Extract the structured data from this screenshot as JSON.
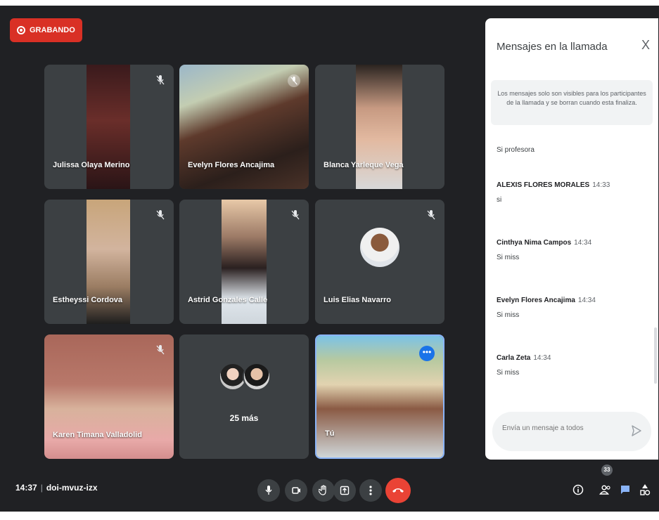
{
  "recording": {
    "label": "GRABANDO"
  },
  "participants": [
    {
      "name": "Julissa Olaya Merino"
    },
    {
      "name": "Evelyn Flores Ancajima"
    },
    {
      "name": "Blanca Yarleque Vega"
    },
    {
      "name": "Estheyssi Cordova"
    },
    {
      "name": "Astrid Gonzales Calle"
    },
    {
      "name": "Luis Elias Navarro"
    },
    {
      "name": "Karen Timana Valladolid"
    }
  ],
  "more_tile": {
    "label": "25 más"
  },
  "self_tile": {
    "name": "Tú"
  },
  "chat": {
    "title": "Mensajes en la llamada",
    "close": "X",
    "info": "Los mensajes solo son visibles para los participantes de la llamada y se borran cuando esta finaliza.",
    "first_text": "Si profesora",
    "messages": [
      {
        "sender": "ALEXIS FLORES MORALES",
        "time": "14:33",
        "text": "si"
      },
      {
        "sender": "Cinthya Nima Campos",
        "time": "14:34",
        "text": "Si miss"
      },
      {
        "sender": "Evelyn Flores Ancajima",
        "time": "14:34",
        "text": "Si miss"
      },
      {
        "sender": "Carla Zeta",
        "time": "14:34",
        "text": "Si miss"
      }
    ],
    "input_placeholder": "Envía un mensaje a todos"
  },
  "bottom": {
    "time": "14:37",
    "separator": "|",
    "meeting_code": "doi-mvuz-izx",
    "participants_count": "33"
  },
  "icons": {
    "mic": "mic-icon",
    "camera": "camera-icon",
    "raise_hand": "hand-icon",
    "present": "present-icon",
    "more": "more-vert-icon",
    "end_call": "end-call-icon",
    "info": "info-icon",
    "people": "people-icon",
    "chat": "chat-icon",
    "activities": "activities-icon"
  },
  "colors": {
    "background": "#202124",
    "tile": "#3c4043",
    "record_red": "#d93025",
    "end_call_red": "#ea4335",
    "accent_blue": "#1a73e8"
  }
}
